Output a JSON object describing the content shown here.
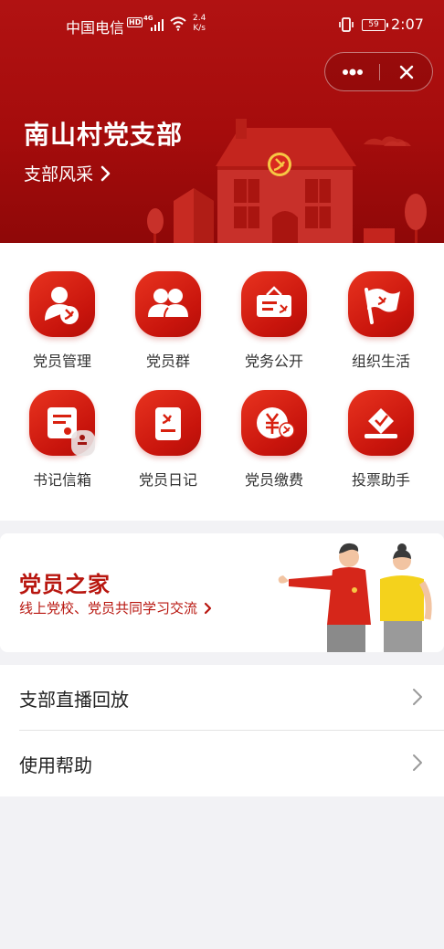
{
  "status_bar": {
    "carrier": "中国电信",
    "hd": "HD",
    "network": "4G",
    "speed_value": "2.4",
    "speed_unit": "K/s",
    "battery": "59",
    "time": "2:07"
  },
  "header": {
    "title": "南山村党支部",
    "subtitle": "支部风采"
  },
  "grid": [
    {
      "label": "党员管理",
      "icon": "member-manage-icon"
    },
    {
      "label": "党员群",
      "icon": "member-group-icon"
    },
    {
      "label": "党务公开",
      "icon": "notice-board-icon"
    },
    {
      "label": "组织生活",
      "icon": "party-flag-icon"
    },
    {
      "label": "书记信箱",
      "icon": "mailbox-icon"
    },
    {
      "label": "党员日记",
      "icon": "diary-icon"
    },
    {
      "label": "党员缴费",
      "icon": "payment-icon"
    },
    {
      "label": "投票助手",
      "icon": "vote-icon"
    }
  ],
  "banner": {
    "title": "党员之家",
    "subtitle": "线上党校、党员共同学习交流"
  },
  "list": [
    {
      "label": "支部直播回放"
    },
    {
      "label": "使用帮助"
    }
  ],
  "colors": {
    "header_red": "#a50c0c",
    "accent_red": "#b8160f",
    "icon_red": "#d8200f",
    "page_bg": "#f2f2f5"
  }
}
